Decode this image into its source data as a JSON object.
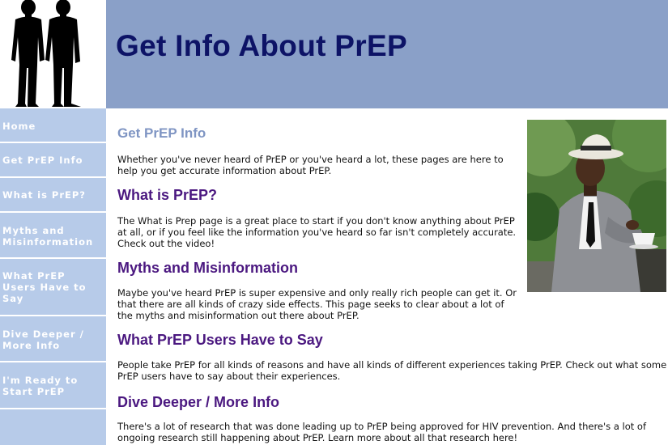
{
  "banner": {
    "title": "Get Info About PrEP"
  },
  "sidebar": {
    "items": [
      {
        "label": "Home"
      },
      {
        "label": "Get PrEP Info"
      },
      {
        "label": "What is PrEP?"
      },
      {
        "label": "Myths and Misinformation"
      },
      {
        "label": "What PrEP Users Have to Say"
      },
      {
        "label": "Dive Deeper / More Info"
      },
      {
        "label": "I'm Ready to Start PrEP"
      }
    ]
  },
  "main": {
    "title": "Get PrEP Info",
    "intro": "Whether you've never heard of PrEP or you've heard a lot, these pages are here to help you get accurate information about PrEP.",
    "sections": [
      {
        "heading": "What is PrEP?",
        "text": "The What is Prep page is a great place to start if you don't know anything about PrEP at all, or if you feel like the information you've heard so far isn't completely accurate. Check out the video!"
      },
      {
        "heading": "Myths and Misinformation",
        "text": "Maybe you've heard PrEP is super expensive and only really rich people can get it. Or that there are all kinds of crazy side effects. This page seeks to clear about a lot of the myths and misinformation out there about PrEP."
      },
      {
        "heading": "What PrEP Users Have to Say",
        "text": "People take PrEP for all kinds of reasons and have all kinds of different experiences taking PrEP. Check out what some PrEP users have to say about their experiences."
      },
      {
        "heading": "Dive Deeper / More Info",
        "text": "There's a lot of research that was done leading up to PrEP being approved for HIV prevention. And there's a lot of ongoing research still happening about PrEP. Learn more about all that research here!"
      }
    ]
  }
}
